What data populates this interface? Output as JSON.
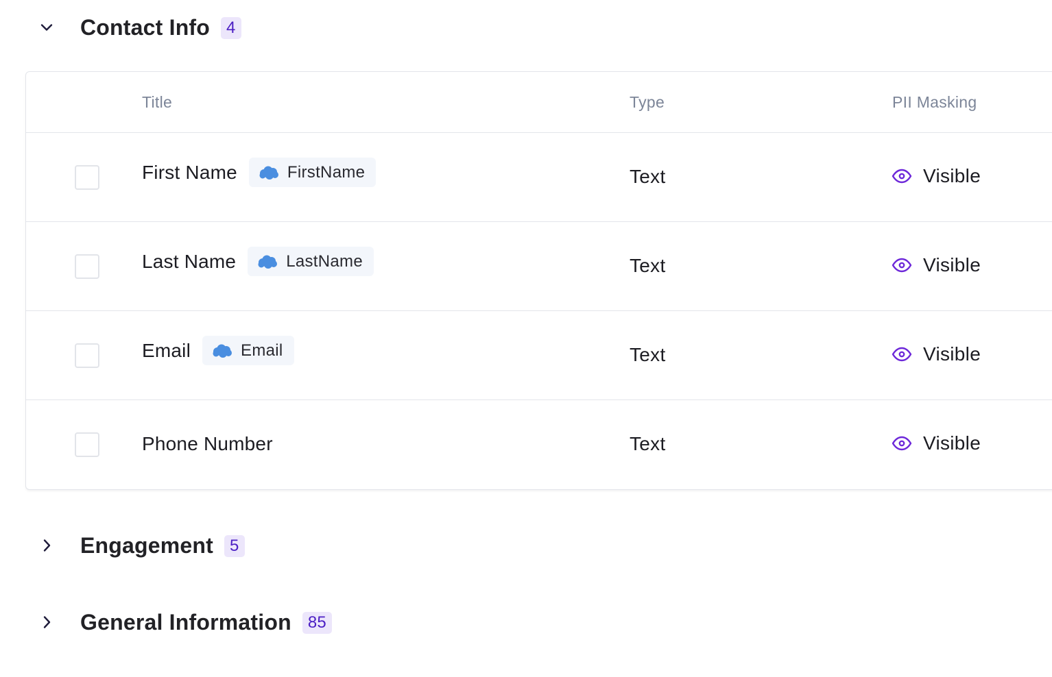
{
  "sections": [
    {
      "title": "Contact Info",
      "count": "4",
      "expanded": true
    },
    {
      "title": "Engagement",
      "count": "5",
      "expanded": false
    },
    {
      "title": "General Information",
      "count": "85",
      "expanded": false
    }
  ],
  "table": {
    "columns": {
      "title": "Title",
      "type": "Type",
      "pii": "PII Masking"
    },
    "rows": [
      {
        "title": "First Name",
        "sf_field": "FirstName",
        "type": "Text",
        "pii": "Visible"
      },
      {
        "title": "Last Name",
        "sf_field": "LastName",
        "type": "Text",
        "pii": "Visible"
      },
      {
        "title": "Email",
        "sf_field": "Email",
        "type": "Text",
        "pii": "Visible"
      },
      {
        "title": "Phone Number",
        "type": "Text",
        "pii": "Visible"
      }
    ]
  },
  "icons": {
    "expanded": "chevron-down-icon",
    "collapsed": "chevron-right-icon",
    "salesforce": "salesforce-cloud-icon",
    "visibility": "eye-icon"
  },
  "colors": {
    "accent": "#6d28d9",
    "badge_bg": "#ece6fb",
    "badge_text": "#4c1fc4",
    "salesforce_blue": "#4a8ee0",
    "header_text": "#7c8598"
  }
}
